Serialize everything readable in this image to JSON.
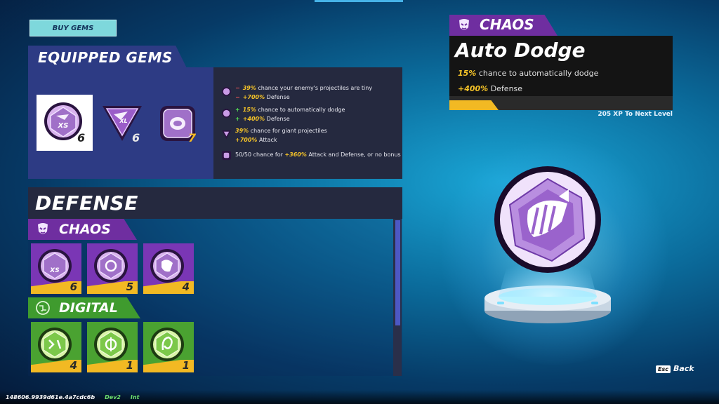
{
  "buy_gems": "BUY GEMS",
  "equipped": {
    "title": "EQUIPPED GEMS",
    "slots": [
      {
        "count": "6",
        "badge": "XS",
        "shape": "hexagon",
        "selected": true
      },
      {
        "count": "6",
        "badge": "XL",
        "shape": "triangle",
        "selected": false
      },
      {
        "count": "7",
        "badge": "",
        "shape": "square",
        "selected": false
      }
    ],
    "effects": [
      [
        {
          "sign": "−",
          "hi": "39%",
          "text": " chance your enemy's projectiles are tiny"
        },
        {
          "sign": "−",
          "hi": "+700%",
          "text": " Defense"
        }
      ],
      [
        {
          "sign": "+",
          "hi": "15%",
          "text": " chance to automatically dodge"
        },
        {
          "sign": "+",
          "hi": "+400%",
          "text": " Defense"
        }
      ],
      [
        {
          "sign": "",
          "hi": "39%",
          "text": " chance for giant projectiles"
        },
        {
          "sign": "",
          "hi": "+700%",
          "text": " Attack"
        }
      ],
      [
        {
          "sign": "",
          "pre": "50/50 chance for ",
          "hi": "+360%",
          "text": " Attack and Defense, or no bonus"
        }
      ]
    ]
  },
  "defense_title": "DEFENSE",
  "categories": [
    {
      "name": "CHAOS",
      "cards": [
        {
          "count": "6",
          "badge": "XS"
        },
        {
          "count": "5",
          "badge": ""
        },
        {
          "count": "4",
          "badge": ""
        }
      ]
    },
    {
      "name": "DIGITAL",
      "cards": [
        {
          "count": "4",
          "badge": ""
        },
        {
          "count": "1",
          "badge": ""
        },
        {
          "count": "1",
          "badge": ""
        }
      ]
    }
  ],
  "detail": {
    "category": "CHAOS",
    "title": "Auto Dodge",
    "line1_hi": "15%",
    "line1_text": " chance to automatically dodge",
    "line2_hi": "+400%",
    "line2_text": " Defense",
    "xp": "205 XP To Next Level"
  },
  "back": {
    "key": "Esc",
    "label": "Back"
  },
  "build": {
    "hash": "148606.9939d61e.4a7cdc6b",
    "env": "Dev2",
    "mode": "Int"
  },
  "colors": {
    "chaos": "#6f2ea0",
    "digital": "#3f9b2e",
    "panel": "#2d3b84",
    "accent": "#f2b923"
  }
}
